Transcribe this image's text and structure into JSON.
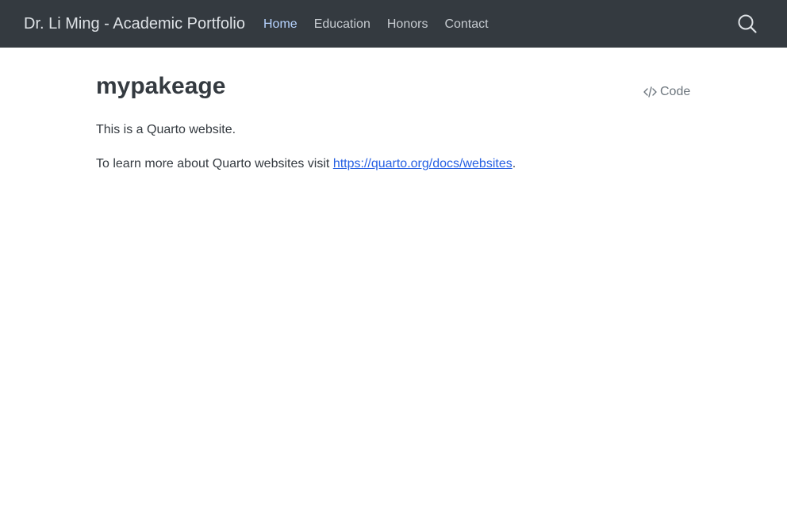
{
  "navbar": {
    "brand": "Dr. Li Ming - Academic Portfolio",
    "links": [
      {
        "label": "Home",
        "active": true
      },
      {
        "label": "Education",
        "active": false
      },
      {
        "label": "Honors",
        "active": false
      },
      {
        "label": "Contact",
        "active": false
      }
    ],
    "search_icon": "search-icon",
    "colors": {
      "background": "#343a40",
      "text": "#dee2e6",
      "active": "#b6d3ff"
    }
  },
  "main": {
    "title": "mypakeage",
    "code_tool": {
      "icon": "code-icon",
      "label": "Code"
    },
    "paragraph1": "This is a Quarto website.",
    "paragraph2_prefix": "To learn more about Quarto websites visit ",
    "paragraph2_link": "https://quarto.org/docs/websites",
    "paragraph2_suffix": ".",
    "link_color": "#2761e3"
  }
}
